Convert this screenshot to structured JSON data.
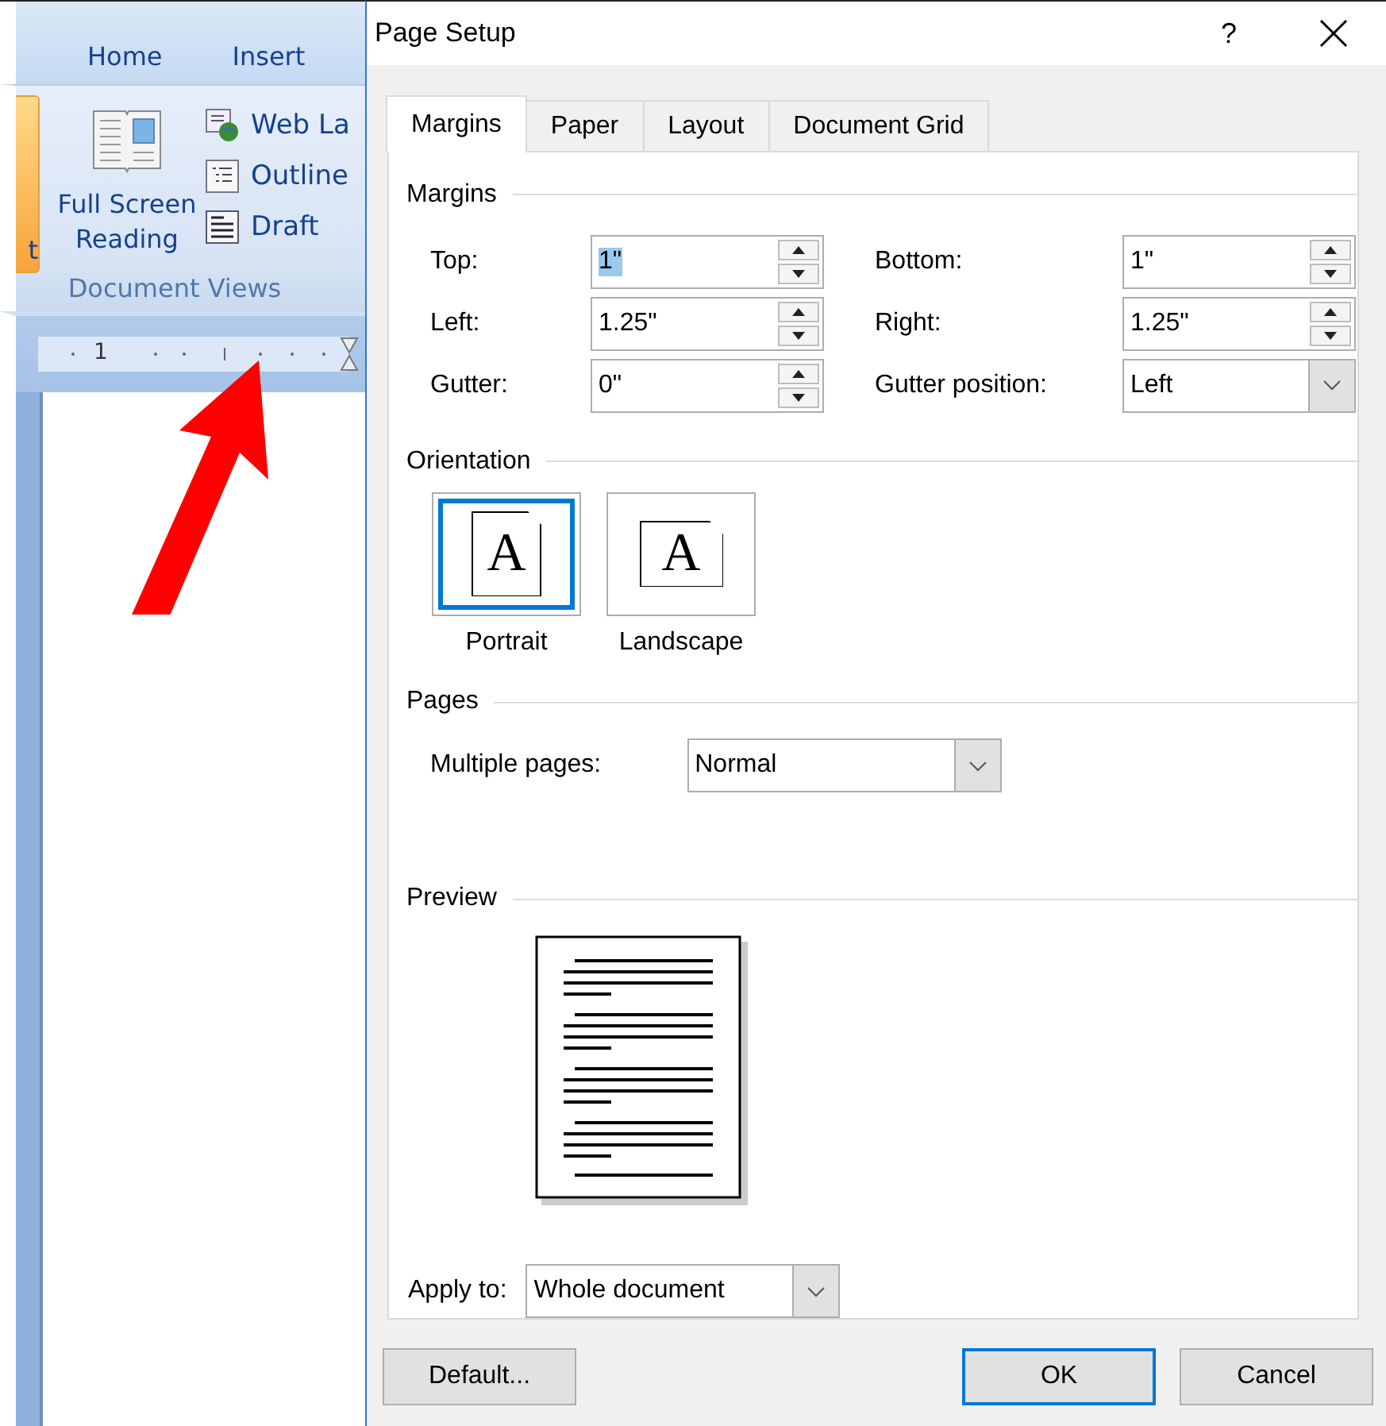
{
  "word": {
    "ribbon_tabs": [
      {
        "label": "Home"
      },
      {
        "label": "Insert"
      }
    ],
    "cut_button_label": "t",
    "views": [
      {
        "kind": "large",
        "label": "Full Screen Reading"
      },
      {
        "kind": "small",
        "label": "Web La"
      },
      {
        "kind": "small",
        "label": "Outline"
      },
      {
        "kind": "small",
        "label": "Draft"
      }
    ],
    "group_label": "Document Views",
    "ruler_label": "1"
  },
  "dialog": {
    "title": "Page Setup",
    "help": "?",
    "tabs": [
      {
        "label": "Margins",
        "selected": true
      },
      {
        "label": "Paper",
        "selected": false
      },
      {
        "label": "Layout",
        "selected": false
      },
      {
        "label": "Document Grid",
        "selected": false
      }
    ],
    "margins": {
      "title": "Margins",
      "fields": [
        {
          "kind": "spin",
          "label": "Top:",
          "value": "1\"",
          "highlighted": true
        },
        {
          "kind": "spin",
          "label": "Bottom:",
          "value": "1\"",
          "highlighted": false
        },
        {
          "kind": "spin",
          "label": "Left:",
          "value": "1.25\"",
          "highlighted": false
        },
        {
          "kind": "spin",
          "label": "Right:",
          "value": "1.25\"",
          "highlighted": false
        },
        {
          "kind": "spin",
          "label": "Gutter:",
          "value": "0\"",
          "highlighted": false
        },
        {
          "kind": "combo",
          "label": "Gutter position:",
          "value": "Left",
          "highlighted": false
        }
      ]
    },
    "orientation": {
      "title": "Orientation",
      "options": [
        {
          "kind": "portrait",
          "label": "Portrait",
          "icon_letter": "A",
          "selected": true
        },
        {
          "kind": "landscape",
          "label": "Landscape",
          "icon_letter": "A",
          "selected": false
        }
      ]
    },
    "pages": {
      "title": "Pages",
      "label": "Multiple pages:",
      "value": "Normal"
    },
    "preview": {
      "title": "Preview"
    },
    "apply": {
      "label": "Apply to:",
      "value": "Whole document"
    },
    "buttons": [
      {
        "label": "Default...",
        "default": false
      },
      {
        "label": "OK",
        "default": true
      },
      {
        "label": "Cancel",
        "default": false
      }
    ]
  }
}
